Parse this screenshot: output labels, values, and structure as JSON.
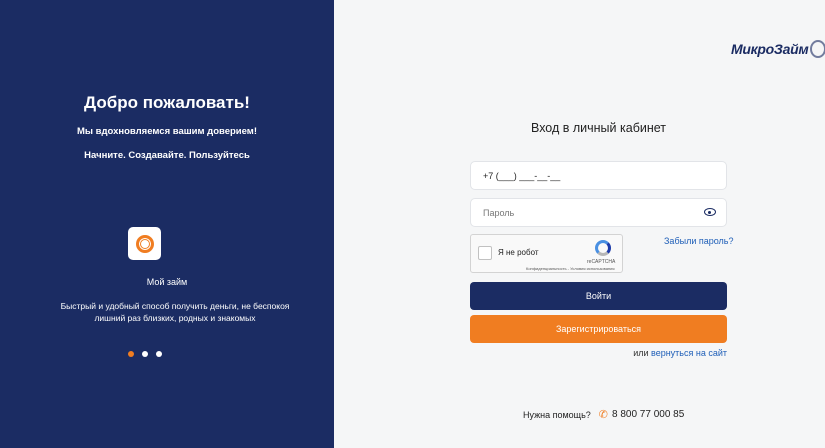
{
  "left": {
    "welcome": "Добро пожаловать!",
    "tagline": "Мы вдохновляемся вашим доверием!",
    "tagline2": "Начните. Создавайте. Пользуйтесь",
    "app_name": "Мой займ",
    "app_desc": "Быстрый и удобный способ получить деньги, не беспокоя лишний раз близких, родных и знакомых",
    "slides": 3,
    "active_slide": 1
  },
  "logo": {
    "text": "МикроЗайм"
  },
  "form": {
    "title": "Вход в личный кабинет",
    "phone_value": "+7 (___) ___-__-__",
    "password_placeholder": "Пароль",
    "forgot": "Забыли пароль?",
    "login_button": "Войти",
    "register_button": "Зарегистрироваться",
    "back_prefix": "или ",
    "back_link": "вернуться на сайт"
  },
  "recaptcha": {
    "label": "Я не робот",
    "brand": "reCAPTCHA",
    "terms": "Конфиденциальность - Условия использования"
  },
  "help": {
    "label": "Нужна помощь?",
    "phone": "8 800 77 000 85"
  },
  "colors": {
    "primary": "#1b2c63",
    "accent": "#f07d21",
    "link": "#1f5fb8"
  }
}
